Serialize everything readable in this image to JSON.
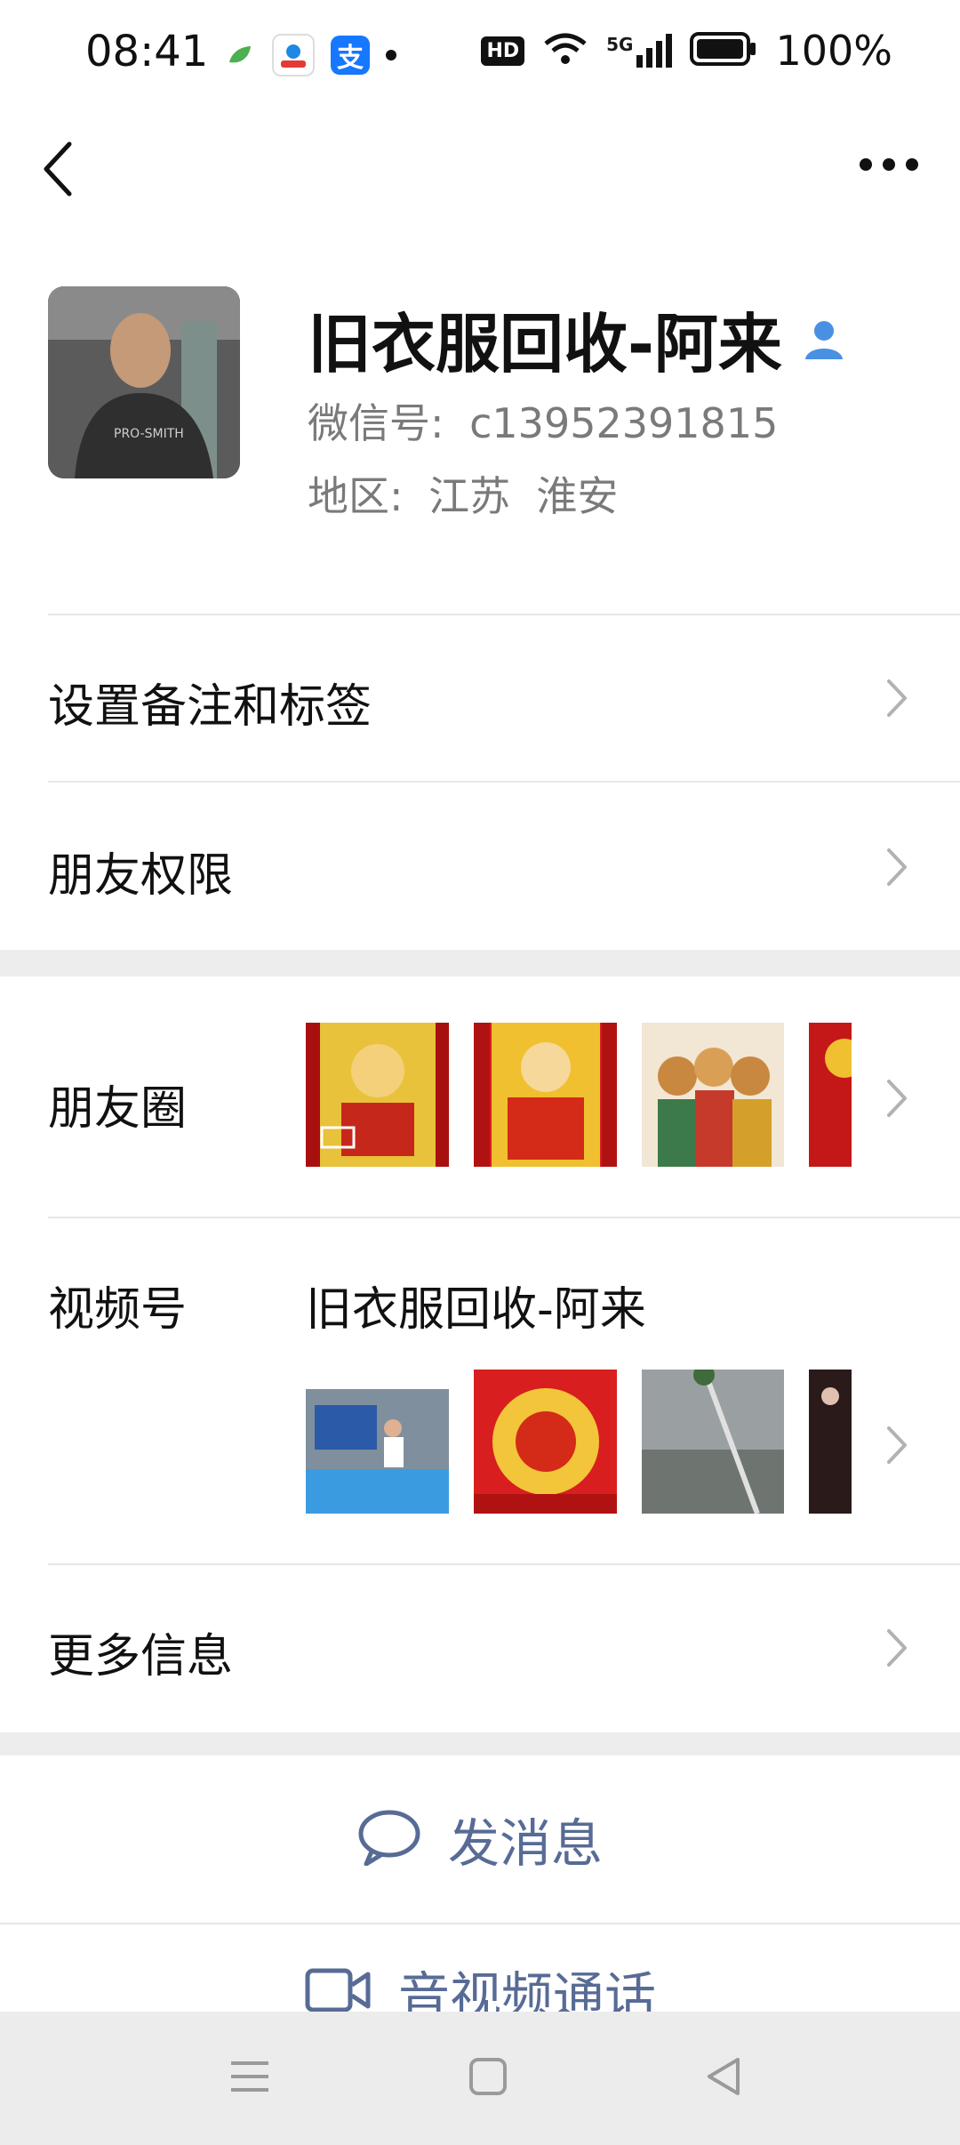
{
  "status_bar": {
    "time": "08:41",
    "app_badge_alipay": "支",
    "signal_label": "5G",
    "hd_label": "HD",
    "battery": "100%"
  },
  "header": {
    "back_icon": "chevron-left-icon",
    "more_icon": "more-dots-icon"
  },
  "profile": {
    "name": "旧衣服回收-阿来",
    "wechat_id_label": "微信号:",
    "wechat_id": "c13952391815",
    "region_label": "地区:",
    "region": "江苏  淮安"
  },
  "menu": {
    "remark_tags": "设置备注和标签",
    "friend_permissions": "朋友权限",
    "moments": "朋友圈",
    "channels": "视频号",
    "channels_name": "旧衣服回收-阿来",
    "more_info": "更多信息"
  },
  "actions": {
    "send_message": "发消息",
    "av_call": "音视频通话"
  },
  "colors": {
    "accent_link": "#576b95",
    "verified_blue": "#4a90e2",
    "band_gray": "#ededed"
  }
}
